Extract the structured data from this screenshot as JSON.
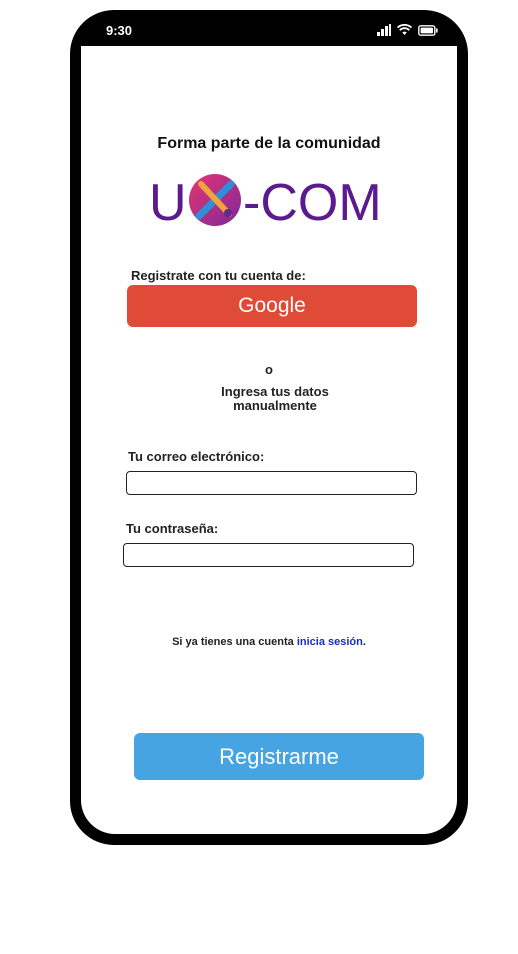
{
  "status_bar": {
    "time": "9:30",
    "icons": [
      "signal-icon",
      "wifi-icon",
      "battery-icon"
    ]
  },
  "header": {
    "title": "Forma parte de la comunidad"
  },
  "logo": {
    "letter_left": "U",
    "letter_right": "-COM",
    "icon": "pencil-brush-cross-icon",
    "colors": {
      "text": "#5B1A8E",
      "circle_start": "#E8346F",
      "circle_end": "#7A2A9C"
    }
  },
  "social": {
    "label": "Registrate con tu cuenta de:",
    "google_label": "Google"
  },
  "divider": {
    "or_text": "o",
    "manual_text": "Ingresa tus datos manualmente"
  },
  "form": {
    "email_label": "Tu correo electrónico:",
    "email_value": "",
    "password_label": "Tu contraseña:",
    "password_value": ""
  },
  "signin": {
    "prefix": "Si ya tienes una cuenta ",
    "link": "inicia sesión",
    "suffix": "."
  },
  "actions": {
    "register_label": "Registrarme"
  },
  "colors": {
    "google": "#E04B38",
    "register": "#47A4E3",
    "link": "#1A2FB5"
  }
}
